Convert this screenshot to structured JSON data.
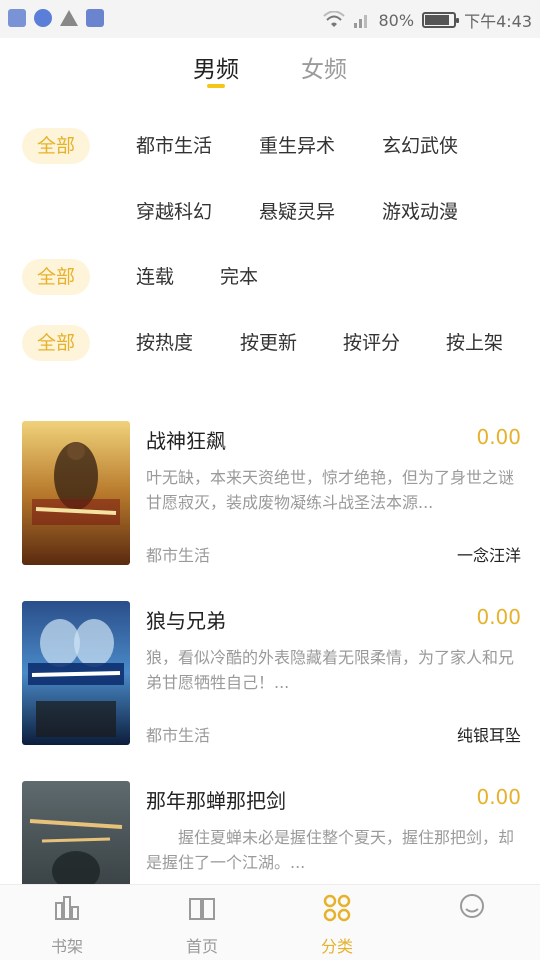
{
  "status_bar": {
    "battery": "80%",
    "time": "下午4:43"
  },
  "gender_tabs": [
    {
      "label": "男频",
      "active": true
    },
    {
      "label": "女频",
      "active": false
    }
  ],
  "filters": {
    "genre": {
      "all": "全部",
      "items": [
        "都市生活",
        "重生异术",
        "玄幻武侠",
        "穿越科幻",
        "悬疑灵异",
        "游戏动漫"
      ]
    },
    "status": {
      "all": "全部",
      "items": [
        "连载",
        "完本"
      ]
    },
    "sort": {
      "all": "全部",
      "items": [
        "按热度",
        "按更新",
        "按评分",
        "按上架"
      ]
    }
  },
  "books": [
    {
      "title": "战神狂飙",
      "price": "0.00",
      "desc": "叶无缺，本来天资绝世，惊才绝艳，但为了身世之谜甘愿寂灭，装成废物凝练斗战圣法本源...",
      "category": "都市生活",
      "author": "一念汪洋"
    },
    {
      "title": "狼与兄弟",
      "price": "0.00",
      "desc": "狼，看似冷酷的外表隐藏着无限柔情，为了家人和兄弟甘愿牺牲自己！...",
      "category": "都市生活",
      "author": "纯银耳坠"
    },
    {
      "title": "那年那蝉那把剑",
      "price": "0.00",
      "desc": "　　握住夏蝉未必是握住整个夏天，握住那把剑，却是握住了一个江湖。...",
      "category": "",
      "author": ""
    }
  ],
  "bottom_nav": [
    {
      "label": "书架",
      "icon": "bookshelf-icon",
      "active": false
    },
    {
      "label": "首页",
      "icon": "book-icon",
      "active": false
    },
    {
      "label": "分类",
      "icon": "category-icon",
      "active": true
    },
    {
      "label": "",
      "icon": "user-icon",
      "active": false
    }
  ],
  "colors": {
    "accent": "#e6b22c",
    "chip_bg": "#fdf4d9"
  }
}
